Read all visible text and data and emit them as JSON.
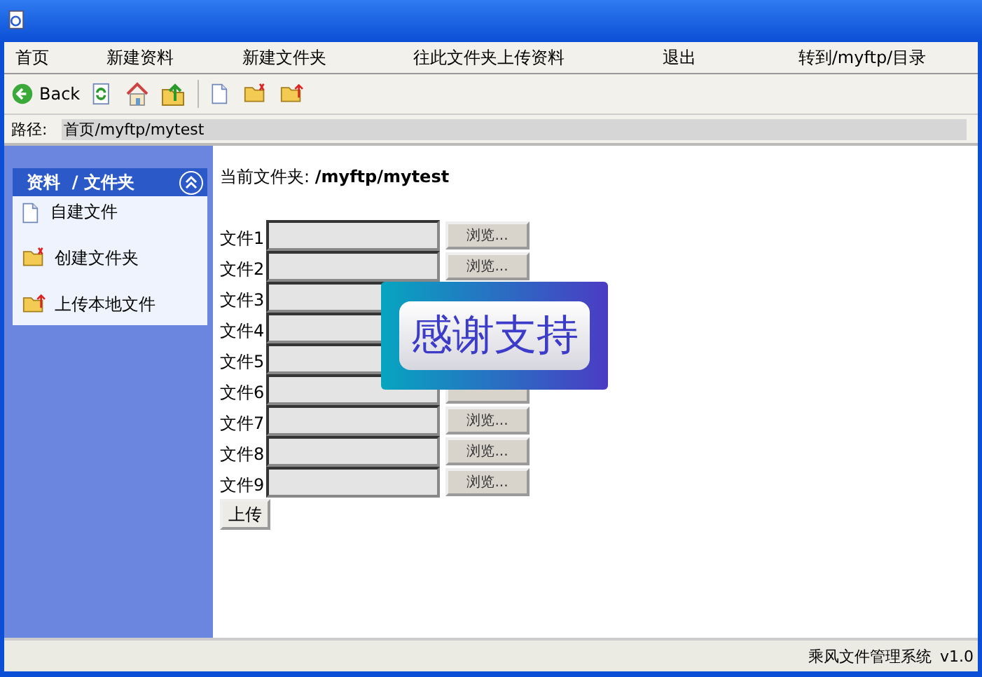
{
  "menu": [
    "首页",
    "新建资料",
    "新建文件夹",
    "往此文件夹上传资料",
    "退出",
    "转到/myftp/目录"
  ],
  "toolbar": {
    "back": "Back"
  },
  "path": {
    "label": "路径:",
    "value": "首页/myftp/mytest"
  },
  "sidebar": {
    "title": "资料  / 文件夹",
    "expanded": true,
    "items": [
      {
        "kind": "file",
        "label": "自建文件"
      },
      {
        "kind": "new-folder",
        "label": "创建文件夹"
      },
      {
        "kind": "upload",
        "label": "上传本地文件"
      }
    ]
  },
  "current": {
    "label": "当前文件夹: ",
    "value": "/myftp/mytest"
  },
  "files": [
    {
      "label": "文件1",
      "browse": "浏览..."
    },
    {
      "label": "文件2",
      "browse": "浏览..."
    },
    {
      "label": "文件3"
    },
    {
      "label": "文件4"
    },
    {
      "label": "文件5"
    },
    {
      "label": "文件6"
    },
    {
      "label": "文件7",
      "browse": "浏览..."
    },
    {
      "label": "文件8",
      "browse": "浏览..."
    },
    {
      "label": "文件9",
      "browse": "浏览..."
    }
  ],
  "upload_button": "上传",
  "overlay": "感谢支持",
  "status_bar": {
    "app": "乘风文件管理系统",
    "version": "v1.0"
  }
}
